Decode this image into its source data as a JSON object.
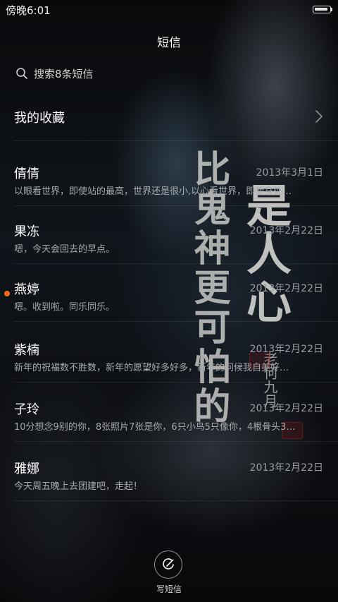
{
  "status_bar": {
    "time": "傍晚6:01",
    "battery_level": 0.75
  },
  "header": {
    "title": "短信"
  },
  "search": {
    "text": "搜索8条短信",
    "icon": "search-icon"
  },
  "favorites": {
    "label": "我的收藏",
    "icon": "chevron-right-icon"
  },
  "conversations": [
    {
      "name": "倩倩",
      "date": "2013年3月1日",
      "snippet": "以眼看世界，即使站的最高，世界还是很小,以心看世界，即使身处…",
      "unread": false
    },
    {
      "name": "果冻",
      "date": "2013年2月22日",
      "snippet": "嗯，今天会回去的早点。",
      "unread": false
    },
    {
      "name": "燕婷",
      "date": "2013年2月22日",
      "snippet": "嗯。收到啦。同乐同乐。",
      "unread": true
    },
    {
      "name": "紫楠",
      "date": "2013年2月22日",
      "snippet": "新年的祝福数不胜数，新年的愿望好多好多，新年的问候我自美好…",
      "unread": false
    },
    {
      "name": "子玲",
      "date": "2013年2月22日",
      "snippet": "10分想念9别的你，8张照片7张是你，6只小鸟5只像你，4根骨头3…",
      "unread": false
    },
    {
      "name": "雅娜",
      "date": "2013年2月22日",
      "snippet": "今天周五晚上去团建吧，走起！",
      "unread": false
    }
  ],
  "compose": {
    "label": "写短信",
    "icon": "compose-icon"
  },
  "wallpaper": {
    "calligraphy_left": "比鬼神更可怕的",
    "calligraphy_right": "是人心",
    "signature": "老何九月"
  },
  "colors": {
    "unread_dot": "#ff6a1e",
    "date_text": "#9a9da2",
    "snippet_text": "#a6a9ad"
  }
}
